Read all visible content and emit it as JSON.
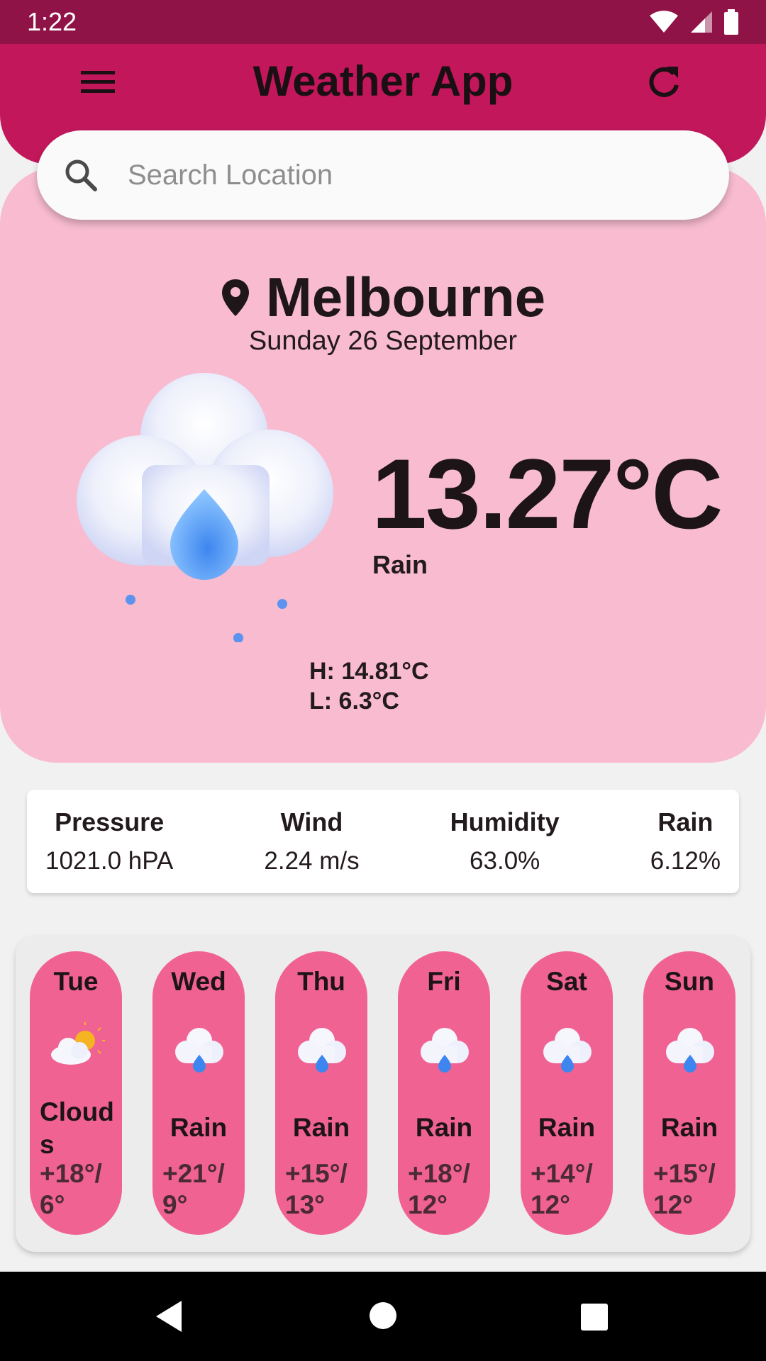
{
  "status_bar": {
    "time": "1:22"
  },
  "app_bar": {
    "title": "Weather App"
  },
  "search": {
    "placeholder": "Search Location"
  },
  "current": {
    "city": "Melbourne",
    "date": "Sunday 26 September",
    "temperature": "13.27°C",
    "condition": "Rain",
    "high": "H: 14.81°C",
    "low": "L: 6.3°C"
  },
  "stats": [
    {
      "label": "Pressure",
      "value": "1021.0 hPA"
    },
    {
      "label": "Wind",
      "value": "2.24 m/s"
    },
    {
      "label": "Humidity",
      "value": "63.0%"
    },
    {
      "label": "Rain",
      "value": "6.12%"
    }
  ],
  "forecast": [
    {
      "day": "Tue",
      "condition": "Cloud s",
      "temp": "+18°/ 6°",
      "icon": "partly-cloudy-icon"
    },
    {
      "day": "Wed",
      "condition": "Rain",
      "temp": "+21°/ 9°",
      "icon": "rain-cloud-icon"
    },
    {
      "day": "Thu",
      "condition": "Rain",
      "temp": "+15°/ 13°",
      "icon": "rain-cloud-icon"
    },
    {
      "day": "Fri",
      "condition": "Rain",
      "temp": "+18°/ 12°",
      "icon": "rain-cloud-icon"
    },
    {
      "day": "Sat",
      "condition": "Rain",
      "temp": "+14°/ 12°",
      "icon": "rain-cloud-icon"
    },
    {
      "day": "Sun",
      "condition": "Rain",
      "temp": "+15°/ 12°",
      "icon": "rain-cloud-icon"
    }
  ],
  "colors": {
    "status_bar": "#8f1346",
    "app_bar": "#c2175b",
    "main_card": "#f8bbd0",
    "day_pill": "#f06292"
  }
}
